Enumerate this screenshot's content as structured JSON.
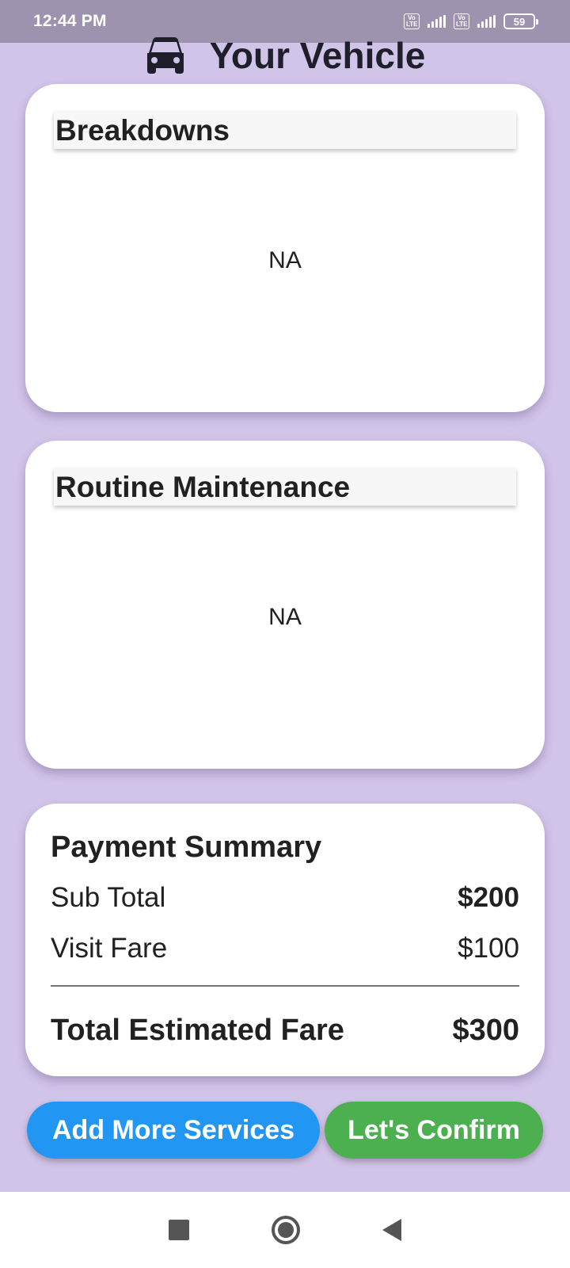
{
  "status_bar": {
    "time": "12:44 PM",
    "sim1_label": "Vo LTE",
    "sim2_label": "Vo LTE",
    "battery_level": "59"
  },
  "header": {
    "icon": "car-icon",
    "title": "Your Vehicle"
  },
  "breakdowns": {
    "title": "Breakdowns",
    "content": "NA"
  },
  "maintenance": {
    "title": "Routine Maintenance",
    "content": "NA"
  },
  "payment": {
    "title": "Payment Summary",
    "sub_total_label": "Sub Total",
    "sub_total_value": "$200",
    "visit_fare_label": "Visit Fare",
    "visit_fare_value": "$100",
    "total_label": "Total Estimated Fare",
    "total_value": "$300"
  },
  "actions": {
    "add_more_label": "Add More Services",
    "confirm_label": "Let's Confirm"
  },
  "colors": {
    "background": "#d1c4e9",
    "status_bar": "#9e93ae",
    "add_button": "#2196f3",
    "confirm_button": "#4caf50"
  },
  "nav_bar": {
    "icons": [
      "recents-icon",
      "home-icon",
      "back-icon"
    ]
  }
}
